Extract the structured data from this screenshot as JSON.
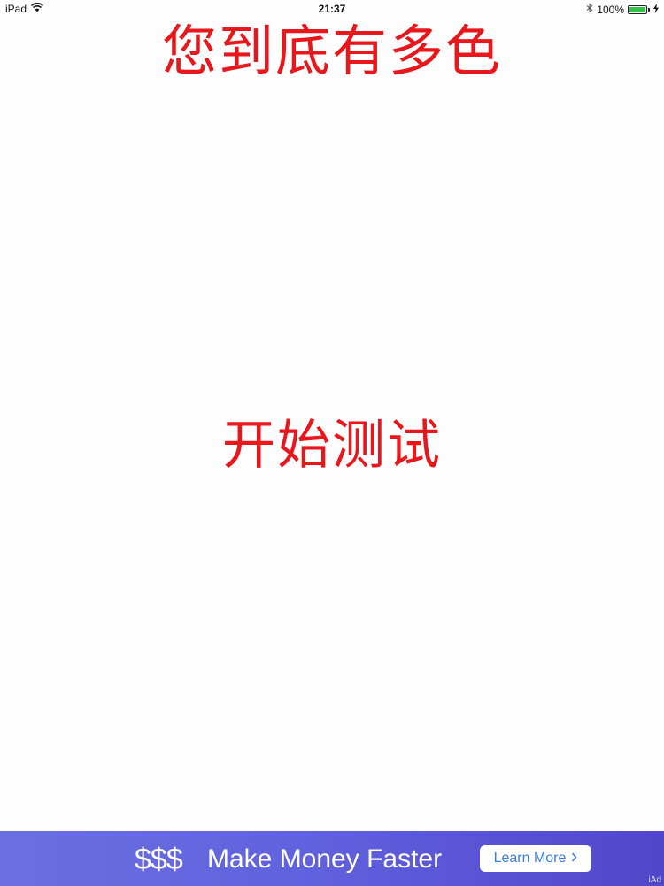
{
  "status_bar": {
    "device": "iPad",
    "time": "21:37",
    "battery_percent": "100%",
    "battery_level": 1.0,
    "wifi_icon": "wifi-icon",
    "bluetooth_icon": "bluetooth-icon",
    "charging_icon": "charging-bolt-icon"
  },
  "main": {
    "title": "您到底有多色",
    "start_label": "开始测试",
    "accent_color": "#e8171b"
  },
  "ad": {
    "symbol": "$$$",
    "headline": "Make Money Faster",
    "cta_label": "Learn More",
    "cta_icon": "chevron-right-icon",
    "tag": "iAd"
  }
}
